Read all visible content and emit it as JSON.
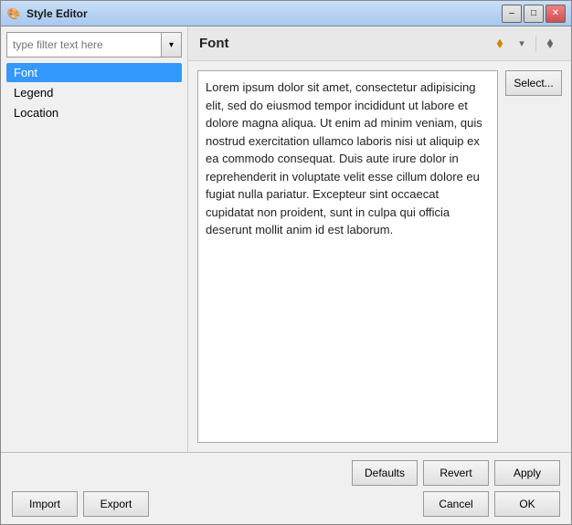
{
  "window": {
    "title": "Style Editor",
    "icon": "🎨"
  },
  "title_buttons": {
    "minimize": "–",
    "maximize": "□",
    "close": "✕"
  },
  "left_panel": {
    "filter_placeholder": "type filter text here",
    "tree_items": [
      {
        "label": "Font",
        "selected": true
      },
      {
        "label": "Legend"
      },
      {
        "label": "Location"
      }
    ]
  },
  "right_panel": {
    "title": "Font",
    "toolbar": {
      "back_icon": "←",
      "dropdown_icon": "▾",
      "forward_icon": "→"
    },
    "preview_text": "Lorem ipsum dolor sit amet, consectetur adipisicing elit, sed do eiusmod tempor incididunt ut labore et dolore magna aliqua. Ut enim ad minim veniam, quis nostrud exercitation ullamco laboris nisi ut aliquip ex ea commodo consequat. Duis aute irure dolor in reprehenderit in voluptate velit esse cillum dolore eu fugiat nulla pariatur. Excepteur sint occaecat cupidatat non proident, sunt in culpa qui officia deserunt mollit anim id est laborum.",
    "select_label": "Select..."
  },
  "bottom_bar": {
    "defaults_label": "Defaults",
    "revert_label": "Revert",
    "apply_label": "Apply",
    "import_label": "Import",
    "export_label": "Export",
    "cancel_label": "Cancel",
    "ok_label": "OK"
  }
}
